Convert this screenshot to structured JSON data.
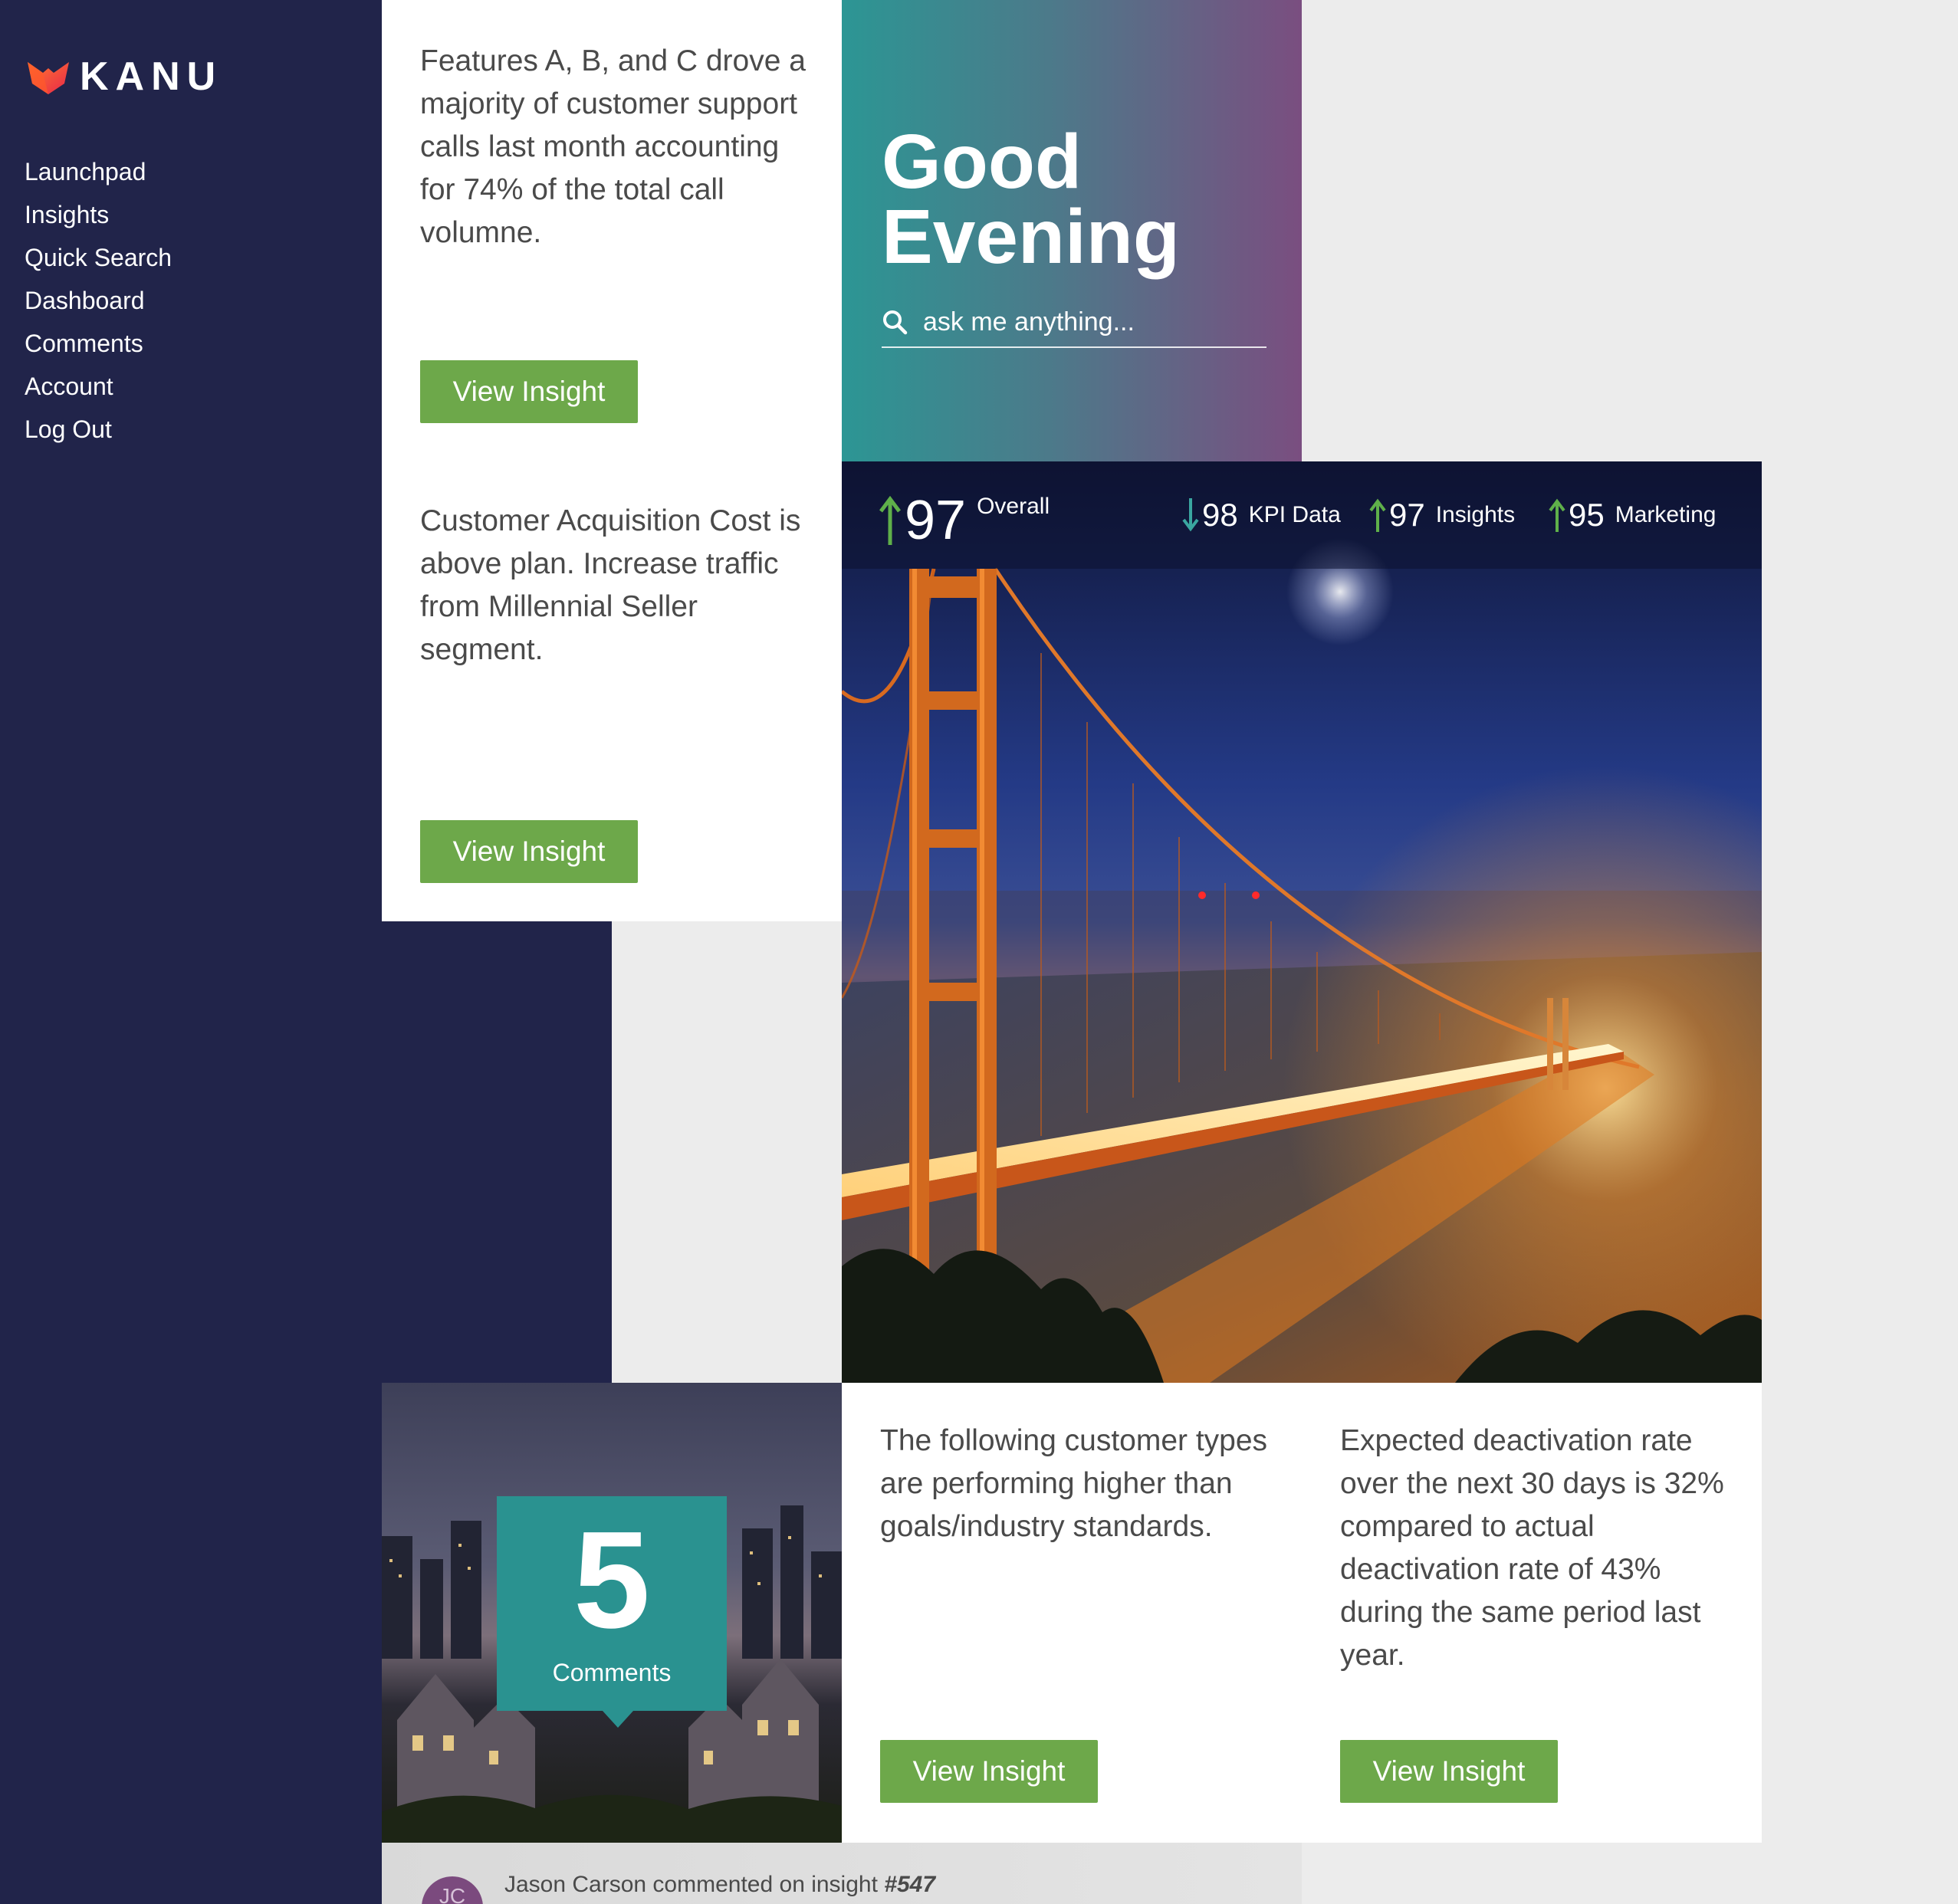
{
  "brand": {
    "name": "KANU"
  },
  "nav": {
    "items": [
      {
        "label": "Launchpad"
      },
      {
        "label": "Insights"
      },
      {
        "label": "Quick Search"
      },
      {
        "label": "Dashboard"
      },
      {
        "label": "Comments"
      },
      {
        "label": "Account"
      },
      {
        "label": "Log Out"
      }
    ]
  },
  "greeting": {
    "line1": "Good",
    "line2": "Evening",
    "search_placeholder": "ask me anything..."
  },
  "kpis": [
    {
      "value": "97",
      "label": "Overall",
      "trend": "up"
    },
    {
      "value": "98",
      "label": "KPI Data",
      "trend": "down"
    },
    {
      "value": "97",
      "label": "Insights",
      "trend": "up"
    },
    {
      "value": "95",
      "label": "Marketing",
      "trend": "up"
    }
  ],
  "insights": [
    {
      "text": "Features A, B, and C drove a majority of customer support calls last month accounting for 74% of the total call volumne.",
      "button": "View Insight"
    },
    {
      "text": "Customer Acquisition Cost is above plan. Increase traffic from Millennial Seller segment.",
      "button": "View Insight"
    },
    {
      "text": "The following customer types are performing higher than goals/industry standards.",
      "button": "View Insight"
    },
    {
      "text": "Expected deactivation rate over the next 30 days is 32% compared to actual deactivation rate of 43% during the same period last year.",
      "button": "View Insight"
    }
  ],
  "comments_badge": {
    "count": "5",
    "label": "Comments"
  },
  "feed": {
    "avatar_initials": "JC",
    "text": "Jason Carson commented on insight ",
    "link": "#547"
  },
  "colors": {
    "sidebar": "#21244a",
    "accent_green": "#6da84a",
    "teal": "#2a9290",
    "trend_up": "#5fb04a",
    "trend_down": "#3aa6a0"
  },
  "icons": {
    "logo": "kanu-logo-icon",
    "search": "search-icon",
    "trend_up": "arrow-up-icon",
    "trend_down": "arrow-down-icon"
  }
}
